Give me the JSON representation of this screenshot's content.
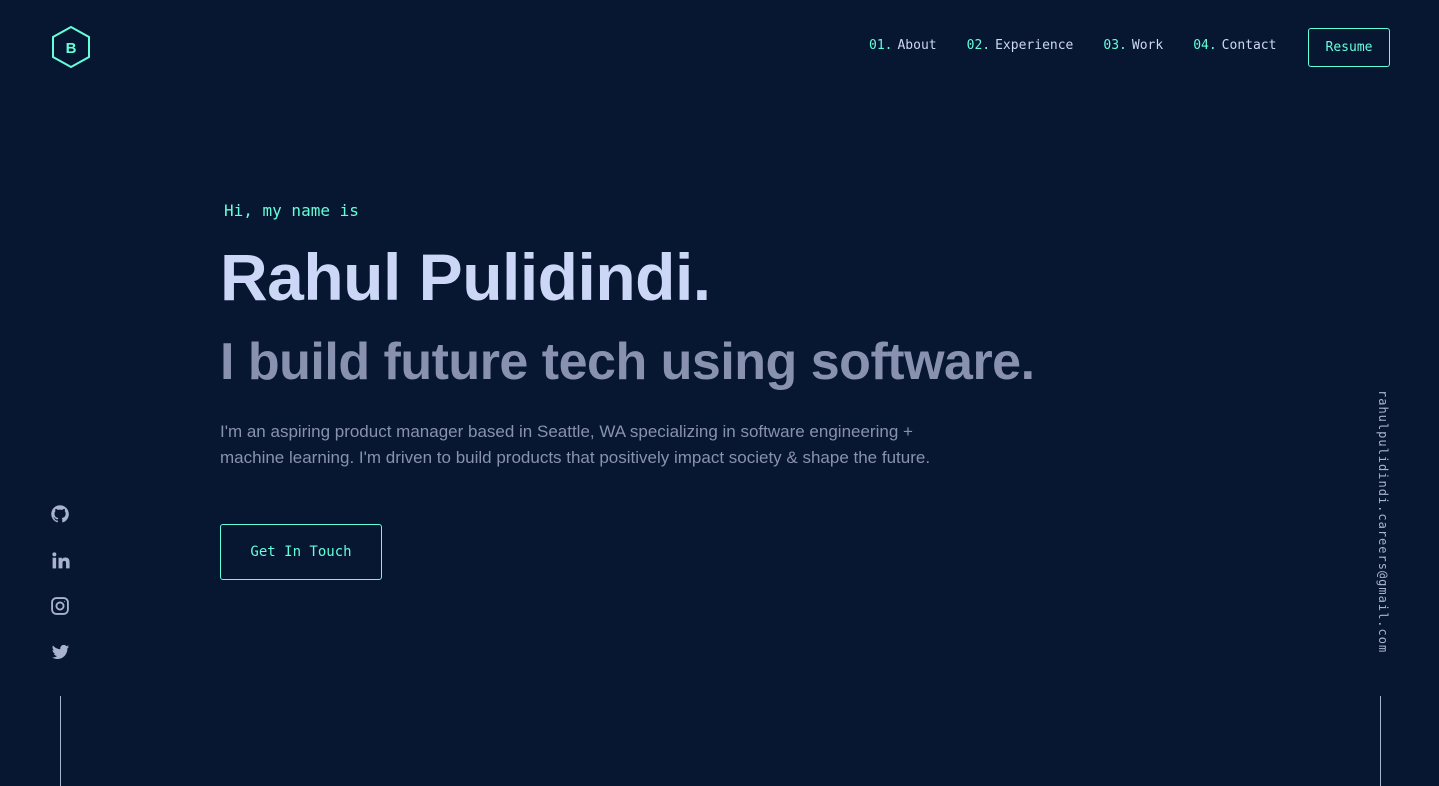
{
  "colors": {
    "background": "#071631",
    "accent": "#64ffda",
    "heading": "#ccd6f6",
    "muted": "#8892b0",
    "icon": "#a8b2d1"
  },
  "logo": {
    "letter": "B",
    "icon": "hexagon-logo-icon"
  },
  "nav": {
    "items": [
      {
        "num": "01.",
        "label": "About"
      },
      {
        "num": "02.",
        "label": "Experience"
      },
      {
        "num": "03.",
        "label": "Work"
      },
      {
        "num": "04.",
        "label": "Contact"
      }
    ],
    "resume_label": "Resume"
  },
  "hero": {
    "intro": "Hi, my name is",
    "name": "Rahul Pulidindi.",
    "tagline": "I build future tech using software.",
    "bio": "I'm an aspiring product manager based in Seattle, WA specializing in software engineering + machine learning. I'm driven to build products that positively impact society & shape the future.",
    "cta_label": "Get In Touch"
  },
  "social": [
    {
      "icon": "github-icon"
    },
    {
      "icon": "linkedin-icon"
    },
    {
      "icon": "instagram-icon"
    },
    {
      "icon": "twitter-icon"
    }
  ],
  "email": "rahulpulidindi.careers@gmail.com"
}
